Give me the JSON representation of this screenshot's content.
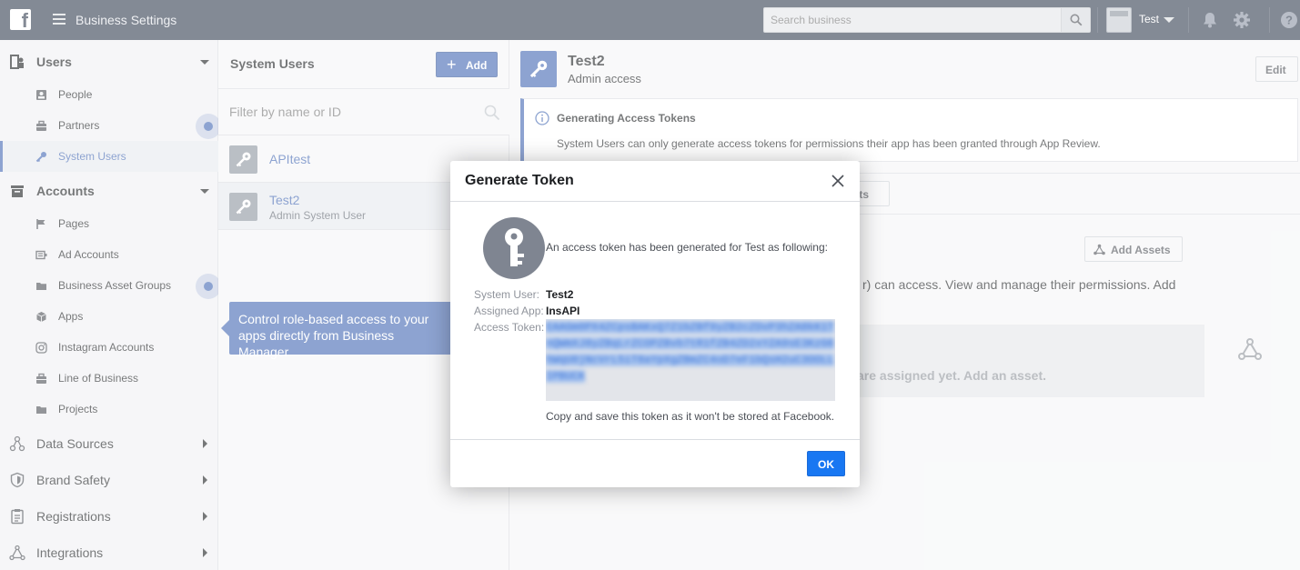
{
  "topbar": {
    "logo": "f",
    "title": "Business Settings",
    "search_placeholder": "Search business",
    "account_name": "Test",
    "icons": [
      "facebook-logo",
      "menu-icon",
      "search-icon",
      "bell-icon",
      "gear-icon",
      "help-icon"
    ]
  },
  "sidebar": {
    "users": {
      "label": "Users",
      "items": [
        {
          "label": "People",
          "icon": "person-icon"
        },
        {
          "label": "Partners",
          "icon": "briefcase-icon"
        },
        {
          "label": "System Users",
          "icon": "key-icon",
          "active": true
        }
      ]
    },
    "accounts": {
      "label": "Accounts",
      "items": [
        {
          "label": "Pages",
          "icon": "flag-icon"
        },
        {
          "label": "Ad Accounts",
          "icon": "ad-icon"
        },
        {
          "label": "Business Asset Groups",
          "icon": "folder-icon"
        },
        {
          "label": "Apps",
          "icon": "cube-icon"
        },
        {
          "label": "Instagram Accounts",
          "icon": "instagram-icon"
        },
        {
          "label": "Line of Business",
          "icon": "briefcase-icon"
        },
        {
          "label": "Projects",
          "icon": "folder-icon"
        }
      ]
    },
    "sections": [
      {
        "label": "Data Sources",
        "icon": "data-sources-icon"
      },
      {
        "label": "Brand Safety",
        "icon": "shield-icon"
      },
      {
        "label": "Registrations",
        "icon": "clipboard-icon"
      },
      {
        "label": "Integrations",
        "icon": "integrations-icon"
      }
    ]
  },
  "system_users": {
    "title": "System Users",
    "add_label": "Add",
    "filter_placeholder": "Filter by name or ID",
    "rows": [
      {
        "name": "APItest",
        "role": ""
      },
      {
        "name": "Test2",
        "role": "Admin System User"
      }
    ],
    "tooltip": "Control role-based access to your apps directly from Business Manager"
  },
  "detail": {
    "name": "Test2",
    "role": "Admin access",
    "edit_label": "Edit",
    "info_title": "Generating Access Tokens",
    "info_text": "System Users can only generate access tokens for permissions their app has been granted through App Review.",
    "assets_tab_partial": "sets",
    "add_assets_label": "Add Assets",
    "desc_partial": "r) can access. View and manage their permissions. Add",
    "empty_partial": "are assigned yet. Add an asset."
  },
  "modal": {
    "title": "Generate Token",
    "message": "An access token has been generated for Test as following:",
    "system_user_label": "System User:",
    "system_user_value": "Test2",
    "assigned_app_label": "Assigned App:",
    "assigned_app_value": "InsAPI",
    "access_token_label": "Access Token:",
    "access_token_value": "EAAGm0PX4ZCpsBAKxQ7Z1bZBf9yZB2cZDvP3hZA8kK1TnQWmXJ8yZBqLrZCOPZBvb7tR1fZB4ZD2xYZA9sE3KzG6hWqU0jNcVrL5iT8aYpXgZBmZC4oD7eF1bQsH2uC3OOLLIPBUCK",
    "copy_note": "Copy and save this token as it won't be stored at Facebook.",
    "ok_label": "OK"
  }
}
